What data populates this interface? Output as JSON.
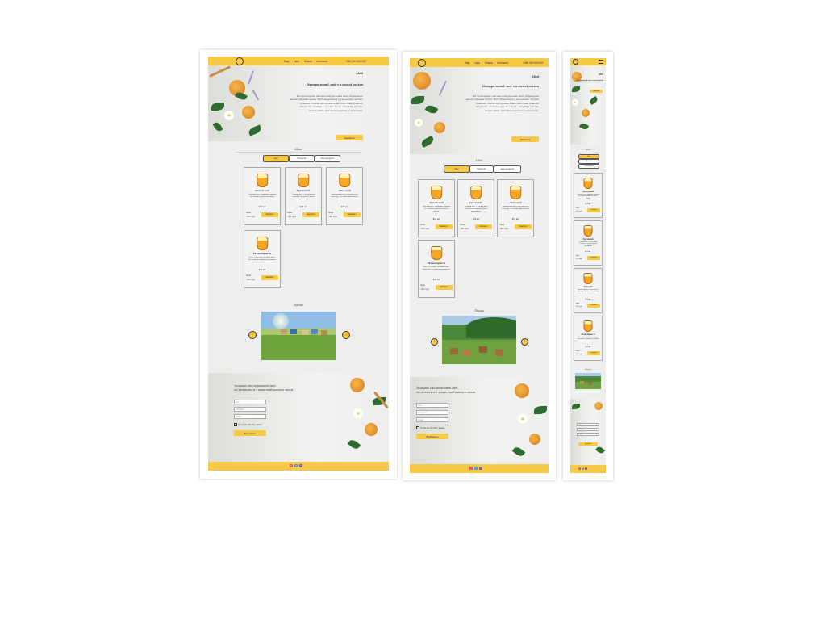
{
  "nav": {
    "items": [
      "Мед",
      "Ціни",
      "Пасіка",
      "Контакти"
    ],
    "phone": "+380 000 000 000"
  },
  "hero": {
    "title": "Мед",
    "subtitle": "Натуральний мед з власної пасіки",
    "text": "Ми пропонуємо якісний натуральний мед, зібраний на нашій сімейній пасіці. Мед збирається у екологічно чистих районах, далеко від промислових зон. Наші бджоли збирають нектар з лугових трав, акації та гречки. Замовляйте мед безпосередньо у пасічника.",
    "button": "Замовити"
  },
  "products": {
    "title": "Ціни",
    "tabs": [
      "Мед",
      "Прополіс",
      "Інші продукти"
    ],
    "items": [
      {
        "name": "Акацієвий",
        "desc": "Світлий мед з ніжним смаком та тонким ароматом квітів акації",
        "weight": "0.5 кг",
        "price_label": "Ціна",
        "price": "150 грн",
        "button": "Замовити"
      },
      {
        "name": "Гречаний",
        "desc": "Темний мед з насиченим смаком та характерною гірчинкою",
        "weight": "0.5 кг",
        "price_label": "Ціна",
        "price": "130 грн",
        "button": "Замовити"
      },
      {
        "name": "Липовий",
        "desc": "Ароматний мед золотистого кольору з легким присмаком",
        "weight": "0.5 кг",
        "price_label": "Ціна",
        "price": "140 грн",
        "button": "Замовити"
      },
      {
        "name": "Різнотрав'я",
        "desc": "Мед з нектару лугових трав, багатий на корисні речовини",
        "weight": "0.5 кг",
        "price_label": "Ціна",
        "price": "120 грн",
        "button": "Замовити"
      }
    ]
  },
  "apiary": {
    "title": "Пасіка",
    "prev": "‹",
    "next": "›"
  },
  "form": {
    "title_line1": "Залиште свої контактні дані,",
    "title_line2": "ми зв'яжемося з вами найближчим часом",
    "name_placeholder": "Ім'я",
    "phone_placeholder": "Телефон",
    "email_placeholder": "Email",
    "consent": "Згода на обробку даних",
    "submit": "Відправити"
  },
  "footer": {
    "socials": [
      "instagram-icon",
      "telegram-icon",
      "viber-icon"
    ]
  },
  "colors": {
    "accent": "#f8c944",
    "background": "#eeeeec"
  }
}
